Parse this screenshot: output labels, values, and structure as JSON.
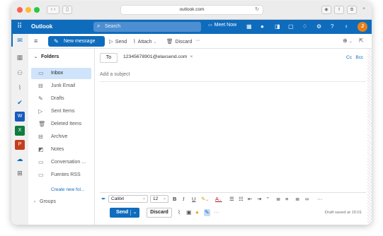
{
  "browser": {
    "url": "outlook.com",
    "colors": {
      "close": "#ff5f57",
      "minimize": "#febc2e",
      "maximize": "#28c840"
    }
  },
  "header": {
    "app_title": "Outlook",
    "search_placeholder": "Search",
    "meet_now_label": "Meet Now",
    "avatar_initial": "J",
    "accent_color": "#0f6cbd",
    "avatar_color": "#e8801a"
  },
  "toolbar": {
    "new_message_label": "New message",
    "send_label": "Send",
    "attach_label": "Attach",
    "discard_label": "Discard",
    "more_label": "···"
  },
  "folders": {
    "section_label": "Folders",
    "items": [
      {
        "label": "Inbox",
        "icon": "inbox-icon"
      },
      {
        "label": "Junk Email",
        "icon": "junk-icon"
      },
      {
        "label": "Drafts",
        "icon": "pencil-icon"
      },
      {
        "label": "Sent Items",
        "icon": "send-icon"
      },
      {
        "label": "Deleted Items",
        "icon": "trash-icon"
      },
      {
        "label": "Archive",
        "icon": "archive-icon"
      },
      {
        "label": "Notes",
        "icon": "note-icon"
      },
      {
        "label": "Conversation ...",
        "icon": "folder-icon"
      },
      {
        "label": "Fuentes RSS",
        "icon": "folder-icon"
      }
    ],
    "create_new_label": "Create new fol...",
    "groups_label": "Groups"
  },
  "compose": {
    "to_label": "To",
    "recipient": "12345678901@elaxsend.com",
    "cc_label": "Cc",
    "bcc_label": "Bcc",
    "subject_placeholder": "Add a subject",
    "font_name": "Calibri",
    "font_size": "12",
    "send_label": "Send",
    "discard_label": "Discard",
    "draft_status": "Draft saved at 15:01"
  }
}
